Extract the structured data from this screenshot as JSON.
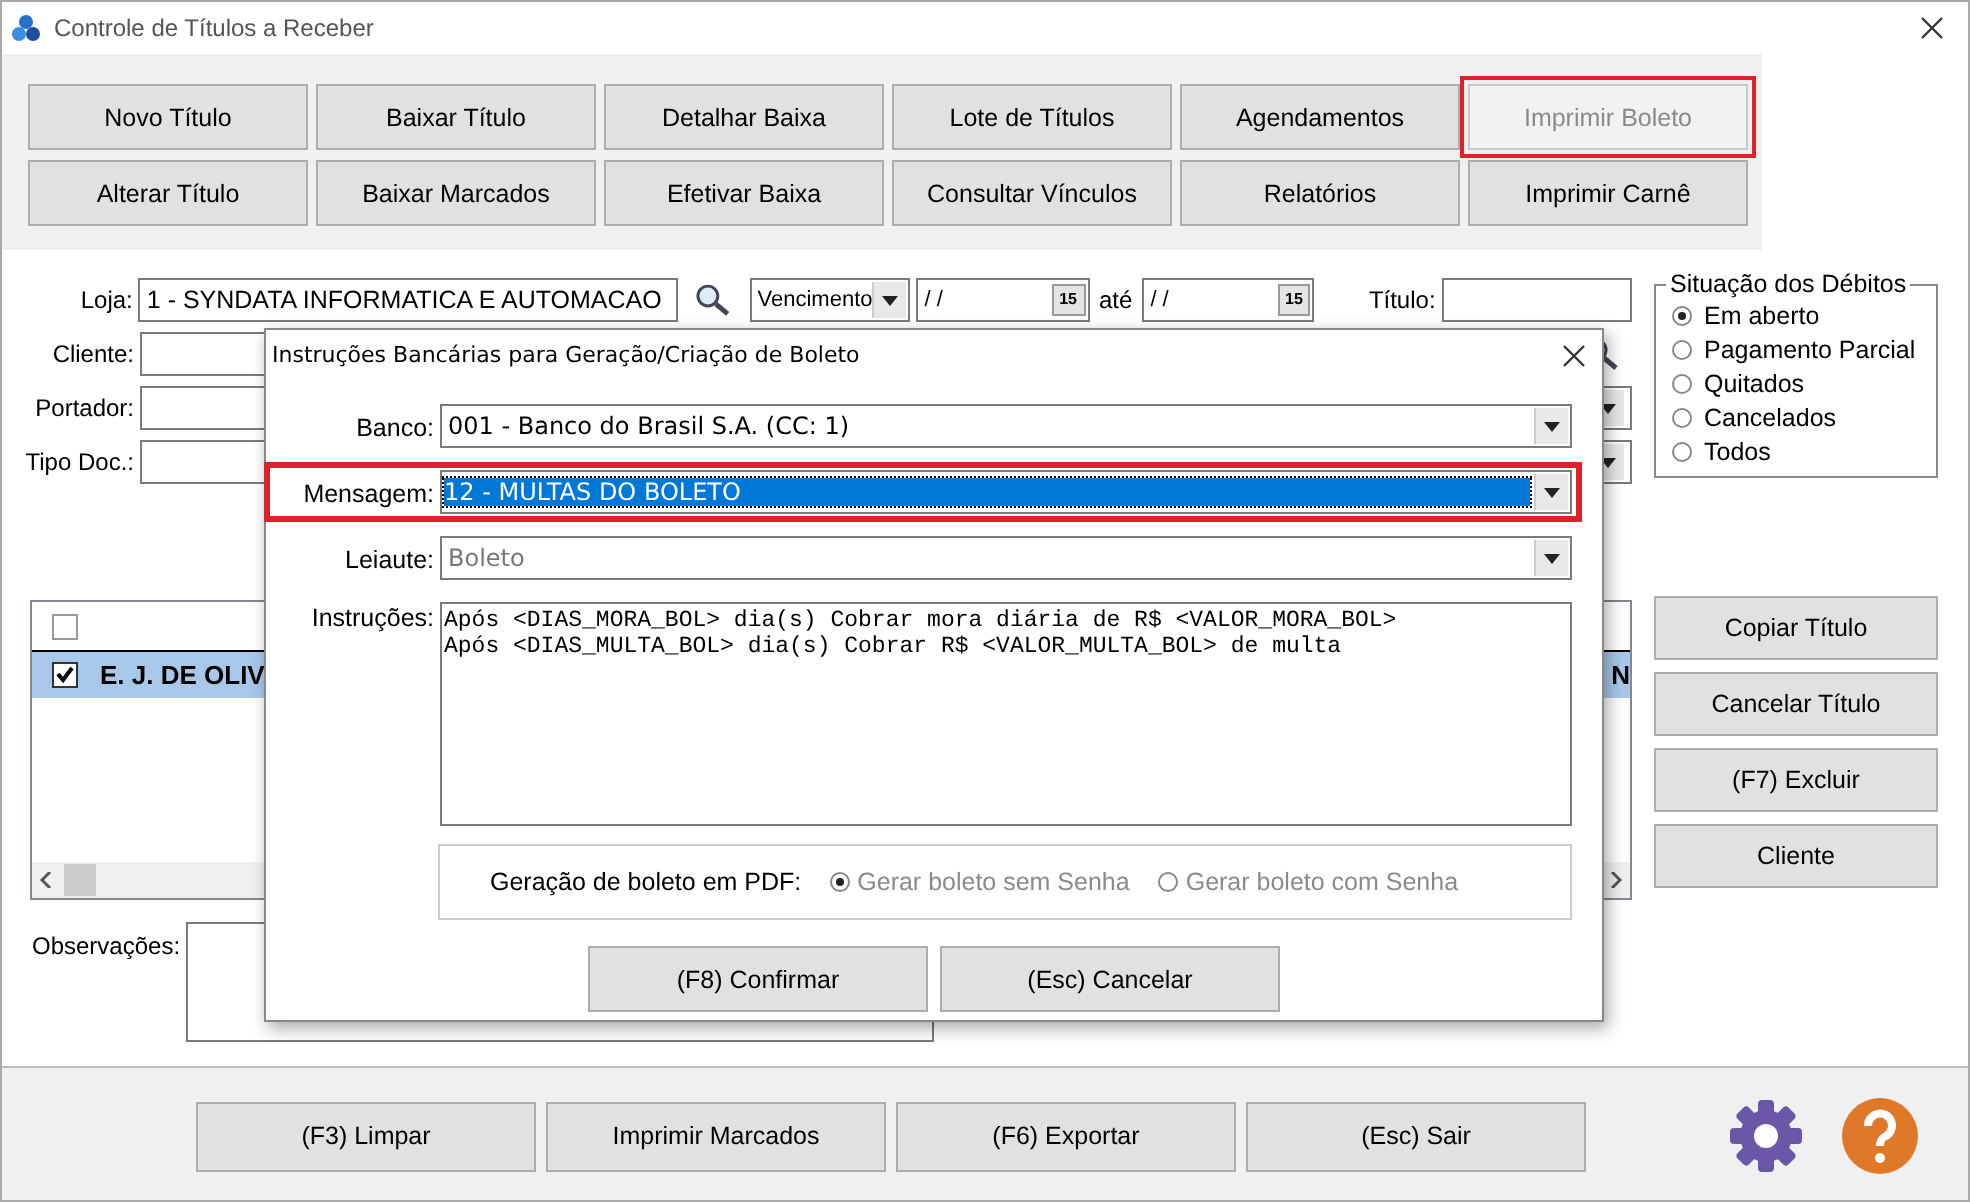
{
  "window": {
    "title": "Controle de Títulos a Receber"
  },
  "toolbar": {
    "buttons": [
      {
        "label": "Novo Título",
        "highlighted": false,
        "disabled": false
      },
      {
        "label": "Baixar Título",
        "highlighted": false,
        "disabled": false
      },
      {
        "label": "Detalhar Baixa",
        "highlighted": false,
        "disabled": false
      },
      {
        "label": "Lote de Títulos",
        "highlighted": false,
        "disabled": false
      },
      {
        "label": "Agendamentos",
        "highlighted": false,
        "disabled": false
      },
      {
        "label": "Imprimir Boleto",
        "highlighted": true,
        "disabled": true
      },
      {
        "label": "Alterar Título",
        "highlighted": false,
        "disabled": false
      },
      {
        "label": "Baixar Marcados",
        "highlighted": false,
        "disabled": false
      },
      {
        "label": "Efetivar Baixa",
        "highlighted": false,
        "disabled": false
      },
      {
        "label": "Consultar Vínculos",
        "highlighted": false,
        "disabled": false
      },
      {
        "label": "Relatórios",
        "highlighted": false,
        "disabled": false
      },
      {
        "label": "Imprimir Carnê",
        "highlighted": false,
        "disabled": false
      }
    ]
  },
  "filters": {
    "loja": {
      "label": "Loja:",
      "value": "1 - SYNDATA INFORMATICA E AUTOMACAO"
    },
    "date_type": {
      "value": "Vencimento"
    },
    "date_from": {
      "value": "/ /",
      "calendar": "15"
    },
    "until_label": "até",
    "date_to": {
      "value": "/ /",
      "calendar": "15"
    },
    "titulo": {
      "label": "Título:"
    },
    "cliente": {
      "label": "Cliente:"
    },
    "portador": {
      "label": "Portador:"
    },
    "tipo_doc": {
      "label": "Tipo Doc.:"
    }
  },
  "situacao": {
    "title": "Situação dos Débitos",
    "options": [
      {
        "label": "Em aberto",
        "selected": true
      },
      {
        "label": "Pagamento Parcial",
        "selected": false
      },
      {
        "label": "Quitados",
        "selected": false
      },
      {
        "label": "Cancelados",
        "selected": false
      },
      {
        "label": "Todos",
        "selected": false
      }
    ]
  },
  "grid": {
    "header_checked": false,
    "rows": [
      {
        "checked": true,
        "selected": true,
        "cells": [
          "E. J. DE OLIV",
          "N"
        ]
      }
    ]
  },
  "observacoes": {
    "label": "Observações:"
  },
  "side_buttons": [
    "Copiar Título",
    "Cancelar Título",
    "(F7) Excluir",
    "Cliente"
  ],
  "bottom_buttons": [
    "(F3) Limpar",
    "Imprimir Marcados",
    "(F6) Exportar",
    "(Esc) Sair"
  ],
  "dialog": {
    "title": "Instruções Bancárias para Geração/Criação de Boleto",
    "fields": [
      {
        "label": "Banco:",
        "value": "001 - Banco do Brasil S.A. (CC: 1)",
        "highlighted": false,
        "focused": false,
        "disabled": false
      },
      {
        "label": "Mensagem:",
        "value": "12 - MULTAS DO BOLETO",
        "highlighted": true,
        "focused": true,
        "disabled": false
      },
      {
        "label": "Leiaute:",
        "value": "Boleto",
        "highlighted": false,
        "focused": false,
        "disabled": true
      }
    ],
    "instructions": {
      "label": "Instruções:",
      "lines": [
        "Após <DIAS_MORA_BOL> dia(s) Cobrar mora diária de R$ <VALOR_MORA_BOL>",
        "Após <DIAS_MULTA_BOL> dia(s) Cobrar R$ <VALOR_MULTA_BOL> de multa"
      ]
    },
    "pdf": {
      "label": "Geração de boleto em PDF:",
      "disabled": true,
      "options": [
        {
          "label": "Gerar boleto sem Senha",
          "selected": true
        },
        {
          "label": "Gerar boleto com Senha",
          "selected": false
        }
      ]
    },
    "buttons": [
      "(F8) Confirmar",
      "(Esc) Cancelar"
    ]
  }
}
